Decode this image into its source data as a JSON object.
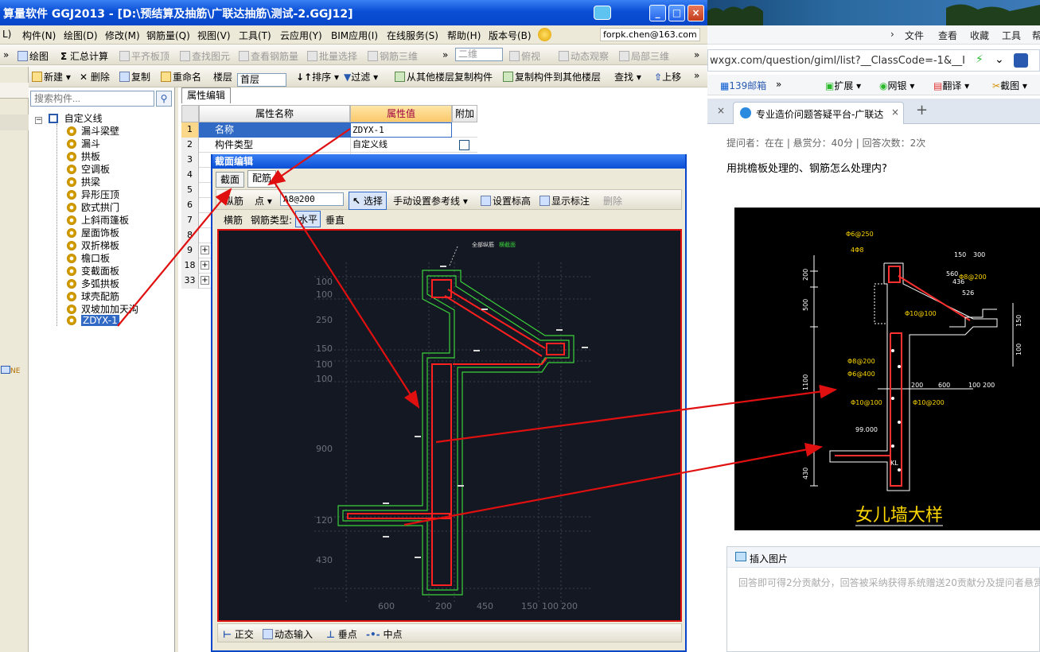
{
  "app": {
    "title": "算量软件 GGJ2013 - [D:\\预结算及抽筋\\广联达抽筋\\测试-2.GGJ12]",
    "min_label": "_",
    "max_label": "□",
    "close_label": "×",
    "user": "forpk.chen@163.com"
  },
  "menu": [
    "L)",
    "构件(N)",
    "绘图(D)",
    "修改(M)",
    "钢筋量(Q)",
    "视图(V)",
    "工具(T)",
    "云应用(Y)",
    "BIM应用(I)",
    "在线服务(S)",
    "帮助(H)",
    "版本号(B)"
  ],
  "toolbar1": {
    "draw": "绘图",
    "sum": "汇总计算",
    "align_top": "平齐板顶",
    "find_elem": "查找图元",
    "view_rebar": "查看钢筋量",
    "batch": "批量选择",
    "rebar3d": "钢筋三维",
    "view2d": "二维",
    "plan": "俯视",
    "dynamic": "动态观察",
    "local3d": "局部三维"
  },
  "toolbar2": {
    "new": "新建",
    "delete": "删除",
    "copy": "复制",
    "rename": "重命名",
    "floor_label": "楼层",
    "floor_value": "首层",
    "sort": "排序",
    "filter": "过滤",
    "copy_from": "从其他楼层复制构件",
    "copy_to": "复制构件到其他楼层",
    "find": "查找",
    "up": "上移"
  },
  "left_strip": {
    "ne": "NE"
  },
  "tree": {
    "search_placeholder": "搜索构件...",
    "root": "自定义线",
    "items": [
      "漏斗梁壁",
      "漏斗",
      "拱板",
      "空调板",
      "拱梁",
      "异形压顶",
      "欧式拱门",
      "上斜雨篷板",
      "屋面饰板",
      "双折梯板",
      "檐口板",
      "变截面板",
      "多弧拱板",
      "球壳配筋",
      "双坡加加天沟",
      "ZDYX-1"
    ]
  },
  "props": {
    "tab": "属性编辑",
    "col_name": "属性名称",
    "col_value": "属性值",
    "col_extra": "附加",
    "rows": [
      {
        "num": "1",
        "name": "名称",
        "value": "ZDYX-1"
      },
      {
        "num": "2",
        "name": "构件类型",
        "value": "自定义线"
      },
      {
        "num": "3",
        "name": "",
        "value": ""
      },
      {
        "num": "4",
        "name": "",
        "value": ""
      },
      {
        "num": "5",
        "name": "",
        "value": ""
      },
      {
        "num": "6",
        "name": "",
        "value": ""
      },
      {
        "num": "7",
        "name": "",
        "value": ""
      },
      {
        "num": "8",
        "name": "",
        "value": ""
      },
      {
        "num": "9",
        "name": "",
        "value": ""
      },
      {
        "num": "18",
        "name": "",
        "value": ""
      },
      {
        "num": "33",
        "name": "",
        "value": ""
      }
    ]
  },
  "dialog": {
    "title": "截面编辑",
    "tab_section": "截面",
    "tab_rebar": "配筋",
    "zongjin": "纵筋",
    "point": "点",
    "spec": "A8@200",
    "select": "选择",
    "manual_ref": "手动设置参考线",
    "set_elev": "设置标高",
    "show_dim": "显示标注",
    "del": "删除",
    "hengjin": "横筋",
    "rebar_type": "钢筋类型:",
    "horizontal": "水平",
    "vertical": "垂直",
    "status": {
      "ortho": "正交",
      "dyn_input": "动态输入",
      "perp": "垂点",
      "mid": "中点"
    },
    "canvas": {
      "top_note": "全部纵筋",
      "top_note2": "横截面",
      "left_dims": [
        "100",
        "100",
        "250",
        "150",
        "100",
        "100",
        "900",
        "120",
        "430"
      ],
      "bottom_dims": [
        "600",
        "200",
        "450",
        "150",
        "100",
        "200"
      ]
    }
  },
  "browser": {
    "menu": [
      "文件",
      "查看",
      "收藏",
      "工具",
      "帮"
    ],
    "url": "wxgx.com/question/giml/list?__ClassCode=-1&__I",
    "fav": {
      "mail": "139邮箱",
      "ext": "扩展",
      "bank": "网银",
      "translate": "翻译",
      "shot": "截图"
    },
    "tab_title": "专业造价问题答疑平台-广联达",
    "meta": "提问者：在在   |   悬赏分：40分   |   回答次数：2次",
    "question": "用挑檐板处理的、钢筋怎么处理内?",
    "drawing": {
      "caption": "女儿墙大样",
      "labels": [
        "Φ6@250",
        "4Φ8",
        "150",
        "300",
        "560",
        "436",
        "526",
        "Φ8@200",
        "200",
        "500",
        "Φ10@100",
        "1100",
        "Φ8@200",
        "Φ6@400",
        "200",
        "600",
        "100",
        "200",
        "Φ10@100",
        "Φ10@200",
        "99.000",
        "KL",
        "430",
        "150",
        "100"
      ]
    },
    "answer_bar": "插入图片",
    "answer_placeholder": "回答即可得2分贡献分，回答被采纳获得系统赠送20贡献分及提问者悬赏"
  },
  "colors": {
    "accent_red": "#e01010",
    "title_blue": "#0a4fd6",
    "selection": "#316ac5",
    "value_col": "#fbd78a"
  }
}
